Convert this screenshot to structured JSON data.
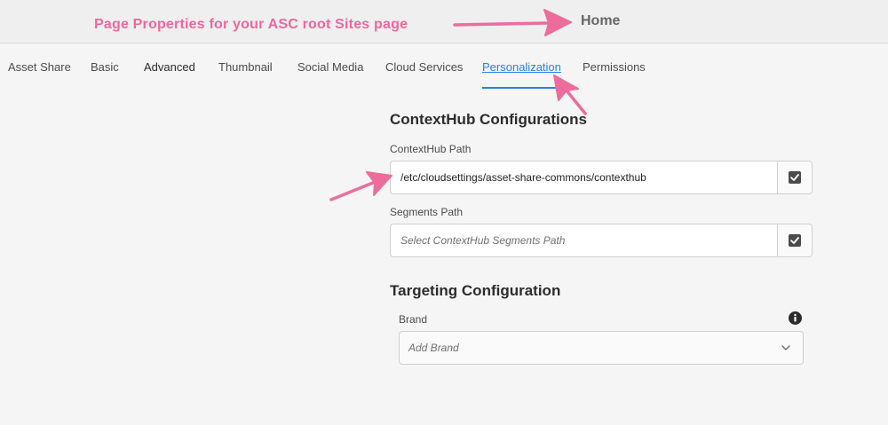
{
  "header": {
    "page_title": "Home",
    "annotation": "Page Properties for your ASC root Sites page"
  },
  "tabs": [
    {
      "label": "Asset Share",
      "active": false
    },
    {
      "label": "Basic",
      "active": false
    },
    {
      "label": "Advanced",
      "active": false
    },
    {
      "label": "Thumbnail",
      "active": false
    },
    {
      "label": "Social Media",
      "active": false
    },
    {
      "label": "Cloud Services",
      "active": false
    },
    {
      "label": "Personalization",
      "active": true
    },
    {
      "label": "Permissions",
      "active": false
    }
  ],
  "contexthub": {
    "heading": "ContextHub Configurations",
    "path_label": "ContextHub Path",
    "path_value": "/etc/cloudsettings/asset-share-commons/contexthub",
    "segments_label": "Segments Path",
    "segments_placeholder": "Select ContextHub Segments Path"
  },
  "targeting": {
    "heading": "Targeting Configuration",
    "brand_label": "Brand",
    "brand_placeholder": "Add Brand"
  },
  "icons": {
    "picker": "checkbox-checked-icon",
    "info": "info-icon",
    "dropdown": "chevron-down-icon"
  },
  "colors": {
    "accent": "#2680eb",
    "annotation": "#f0679b"
  }
}
